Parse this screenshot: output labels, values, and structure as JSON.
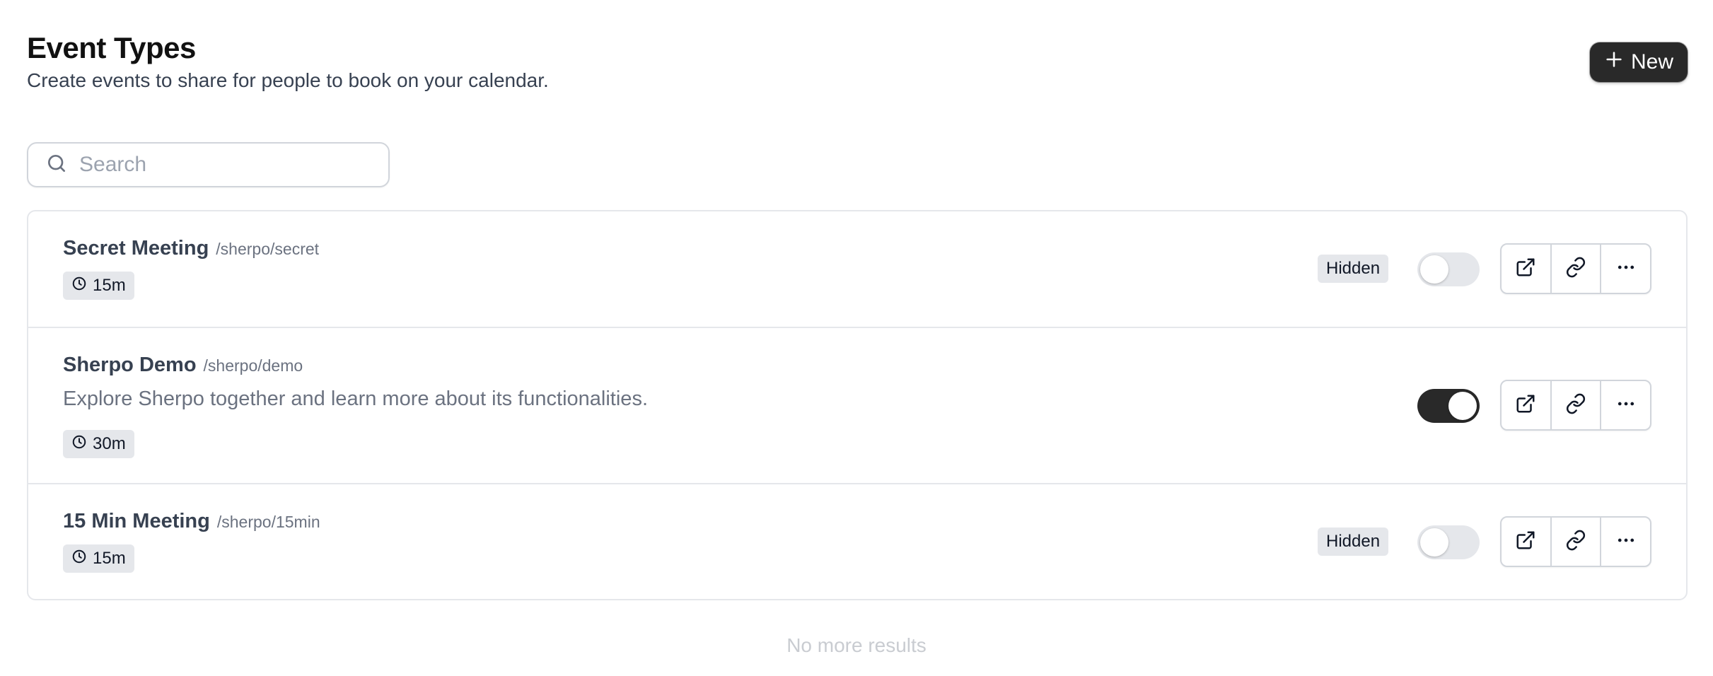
{
  "header": {
    "title": "Event Types",
    "subtitle": "Create events to share for people to book on your calendar.",
    "new_button_label": "New"
  },
  "search": {
    "placeholder": "Search",
    "value": ""
  },
  "events": [
    {
      "title": "Secret Meeting",
      "slug": "/sherpo/secret",
      "description": "",
      "duration": "15m",
      "hidden_label": "Hidden",
      "enabled": false
    },
    {
      "title": "Sherpo Demo",
      "slug": "/sherpo/demo",
      "description": "Explore Sherpo together and learn more about its functionalities.",
      "duration": "30m",
      "hidden_label": "",
      "enabled": true
    },
    {
      "title": "15 Min Meeting",
      "slug": "/sherpo/15min",
      "description": "",
      "duration": "15m",
      "hidden_label": "Hidden",
      "enabled": false
    }
  ],
  "footer": {
    "no_more_results": "No more results"
  },
  "icons": {
    "new": "plus-icon",
    "search": "search-icon",
    "duration": "clock-icon",
    "preview": "external-link-icon",
    "copy_link": "link-icon",
    "more": "more-horizontal-icon"
  },
  "colors": {
    "primary_button": "#292929",
    "toggle_on": "#292929",
    "toggle_off": "#e5e7eb",
    "badge_bg": "#e5e7eb"
  }
}
